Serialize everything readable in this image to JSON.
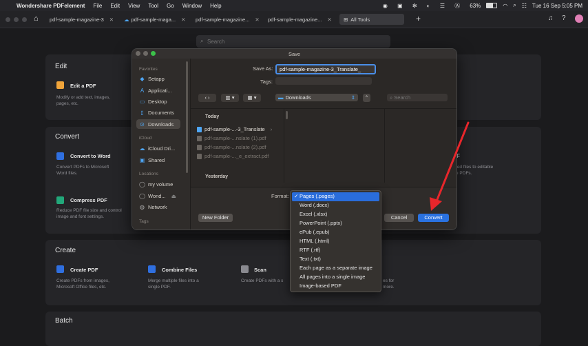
{
  "menubar": {
    "app_name": "Wondershare PDFelement",
    "items": [
      "File",
      "Edit",
      "View",
      "Tool",
      "Go",
      "Window",
      "Help"
    ],
    "battery": "63%",
    "datetime": "Tue 16 Sep  5:05 PM"
  },
  "tabs": [
    {
      "label": "pdf-sample-magazine-3"
    },
    {
      "label": "pdf-sample-maga..."
    },
    {
      "label": "pdf-sample-magazine..."
    },
    {
      "label": "pdf-sample-magazine..."
    },
    {
      "label": "All Tools"
    }
  ],
  "search": {
    "placeholder": "Search"
  },
  "sections": {
    "edit": {
      "title": "Edit",
      "tool_title": "Edit a PDF",
      "tool_desc": "Modify or add text, images,\npages, etc."
    },
    "convert": {
      "title": "Convert",
      "to_word_title": "Convert to Word",
      "to_word_desc": "Convert PDFs to Microsoft\nWord files.",
      "compress_title": "Compress PDF",
      "compress_desc": "Reduce PDF file size and control\nimage and font settings.",
      "right_desc": "ted files to editable\ne PDFs."
    },
    "create": {
      "title": "Create",
      "create_title": "Create PDF",
      "create_desc": "Create PDFs from images,\nMicrosoft Office files, etc.",
      "combine_title": "Combine Files",
      "combine_desc": "Merge multiple files into a\nsingle PDF.",
      "scan_title": "Scan",
      "scan_desc": "Create PDFs with a s",
      "right_desc": "es for\n more."
    },
    "batch": {
      "title": "Batch"
    }
  },
  "dialog": {
    "title": "Save",
    "save_as_label": "Save As:",
    "save_as_value": "pdf-sample-magazine-3_Translate_",
    "tags_label": "Tags:",
    "location": "Downloads",
    "search_placeholder": "Search",
    "sidebar": {
      "favorites_head": "Favorites",
      "favorites": [
        "Setapp",
        "Applicati...",
        "Desktop",
        "Documents",
        "Downloads"
      ],
      "icloud_head": "iCloud",
      "icloud": [
        "iCloud Dri...",
        "Shared"
      ],
      "locations_head": "Locations",
      "locations": [
        "my volume",
        "Wond...",
        "Network"
      ],
      "tags_head": "Tags"
    },
    "groups": {
      "today": "Today",
      "yesterday": "Yesterday"
    },
    "files": [
      "pdf-sample-...-3_Translate",
      "pdf-sample-...nslate (1).pdf",
      "pdf-sample-...nslate (2).pdf",
      "pdf-sample-..._e_extract.pdf"
    ],
    "format_label": "Format:",
    "new_folder": "New Folder",
    "cancel": "Cancel",
    "convert": "Convert"
  },
  "format_menu": {
    "selected": "Pages (.pages)",
    "options": [
      "Pages (.pages)",
      "Word (.docx)",
      "Excel (.xlsx)",
      "PowerPoint (.pptx)",
      "ePub (.epub)",
      "HTML (.html)",
      "RTF (.rtf)",
      "Text (.txt)",
      "Each page as a separate image",
      "All pages into a single image",
      "Image-based PDF"
    ]
  },
  "colors": {
    "accent": "#2a72e0",
    "arrow": "#e8262b"
  }
}
